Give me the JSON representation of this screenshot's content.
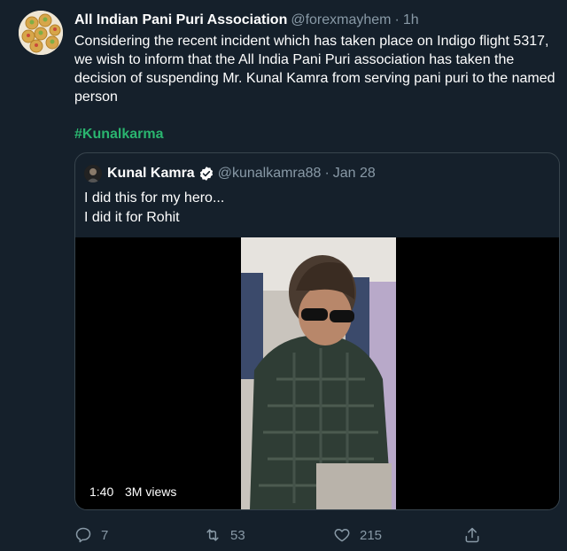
{
  "tweet": {
    "name": "All Indian Pani Puri Association",
    "handle": "@forexmayhem",
    "separator": "·",
    "time": "1h",
    "text": "Considering the recent incident which has taken place on Indigo flight 5317, we wish to inform that the All India Pani Puri association has taken the decision of suspending Mr. Kunal Kamra from serving pani puri to the named person",
    "hashtag": "#Kunalkarma"
  },
  "quote": {
    "name": "Kunal Kamra",
    "handle": "@kunalkamra88",
    "separator": "·",
    "date": "Jan 28",
    "text": "I did this for my hero...\nI did it for Rohit",
    "video": {
      "duration": "1:40",
      "views": "3M views"
    }
  },
  "actions": {
    "reply_count": "7",
    "retweet_count": "53",
    "like_count": "215"
  },
  "colors": {
    "background": "#15202b",
    "hashtag": "#2ab56f",
    "muted": "#8899a6",
    "verified": "#ffffff"
  },
  "icons": [
    "reply-icon",
    "retweet-icon",
    "like-icon",
    "share-icon",
    "verified-badge-icon"
  ]
}
